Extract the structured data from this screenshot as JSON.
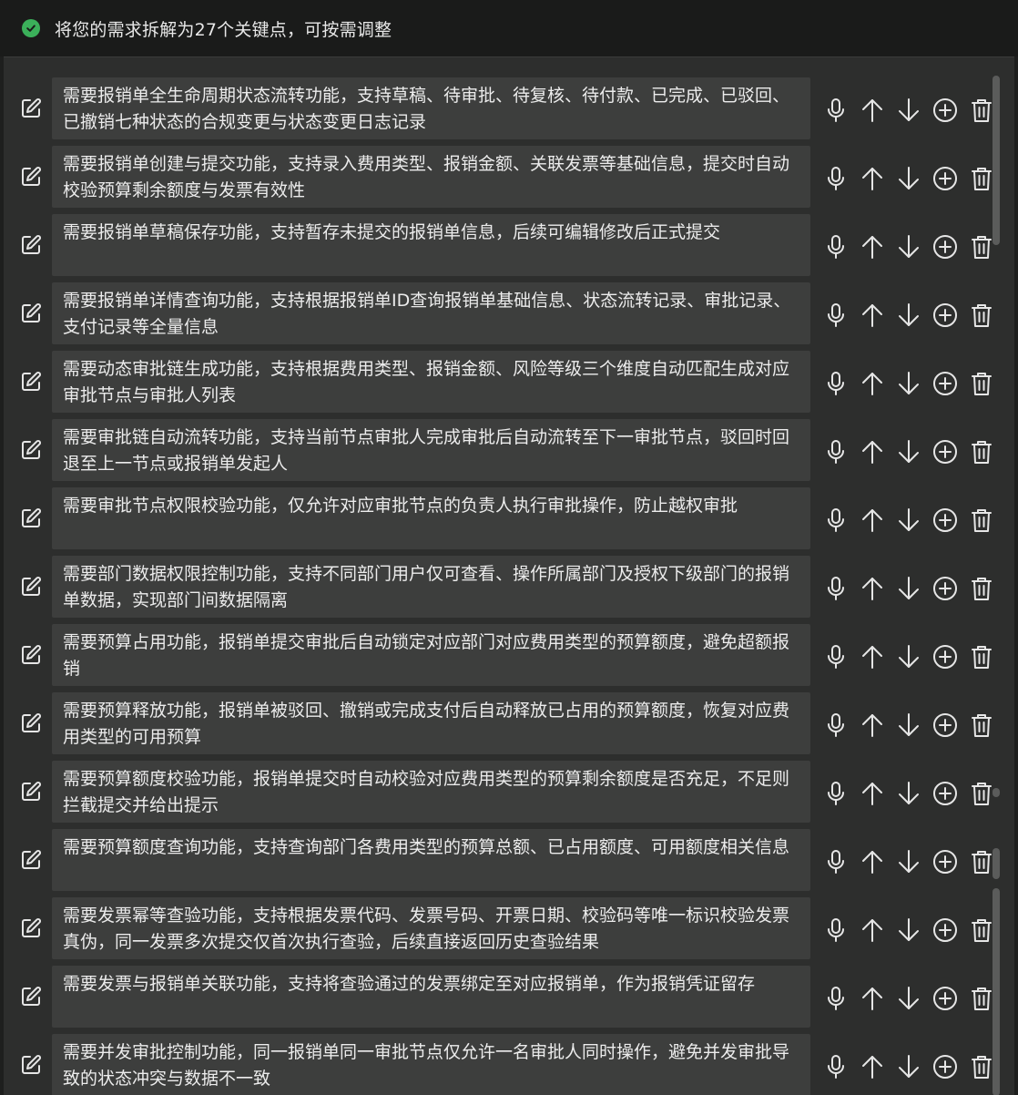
{
  "header": {
    "title": "将您的需求拆解为27个关键点，可按需调整",
    "status_icon": "check-circle-icon",
    "accent": "#3bb05a"
  },
  "items": [
    {
      "text": "需要报销单全生命周期状态流转功能，支持草稿、待审批、待复核、待付款、已完成、已驳回、已撤销七种状态的合规变更与状态变更日志记录"
    },
    {
      "text": "需要报销单创建与提交功能，支持录入费用类型、报销金额、关联发票等基础信息，提交时自动校验预算剩余额度与发票有效性"
    },
    {
      "text": "需要报销单草稿保存功能，支持暂存未提交的报销单信息，后续可编辑修改后正式提交"
    },
    {
      "text": "需要报销单详情查询功能，支持根据报销单ID查询报销单基础信息、状态流转记录、审批记录、支付记录等全量信息"
    },
    {
      "text": "需要动态审批链生成功能，支持根据费用类型、报销金额、风险等级三个维度自动匹配生成对应审批节点与审批人列表"
    },
    {
      "text": "需要审批链自动流转功能，支持当前节点审批人完成审批后自动流转至下一审批节点，驳回时回退至上一节点或报销单发起人"
    },
    {
      "text": "需要审批节点权限校验功能，仅允许对应审批节点的负责人执行审批操作，防止越权审批"
    },
    {
      "text": "需要部门数据权限控制功能，支持不同部门用户仅可查看、操作所属部门及授权下级部门的报销单数据，实现部门间数据隔离"
    },
    {
      "text": "需要预算占用功能，报销单提交审批后自动锁定对应部门对应费用类型的预算额度，避免超额报销"
    },
    {
      "text": "需要预算释放功能，报销单被驳回、撤销或完成支付后自动释放已占用的预算额度，恢复对应费用类型的可用预算"
    },
    {
      "text": "需要预算额度校验功能，报销单提交时自动校验对应费用类型的预算剩余额度是否充足，不足则拦截提交并给出提示"
    },
    {
      "text": "需要预算额度查询功能，支持查询部门各费用类型的预算总额、已占用额度、可用额度相关信息"
    },
    {
      "text": "需要发票幂等查验功能，支持根据发票代码、发票号码、开票日期、校验码等唯一标识校验发票真伪，同一发票多次提交仅首次执行查验，后续直接返回历史查验结果"
    },
    {
      "text": "需要发票与报销单关联功能，支持将查验通过的发票绑定至对应报销单，作为报销凭证留存"
    },
    {
      "text": "需要并发审批控制功能，同一报销单同一审批节点仅允许一名审批人同时操作，避免并发审批导致的状态冲突与数据不一致"
    }
  ],
  "row_actions": [
    {
      "name": "mic-icon",
      "label": "voice"
    },
    {
      "name": "arrow-up-icon",
      "label": "move-up"
    },
    {
      "name": "arrow-down-icon",
      "label": "move-down"
    },
    {
      "name": "plus-circle-icon",
      "label": "add"
    },
    {
      "name": "trash-icon",
      "label": "delete"
    }
  ],
  "colors": {
    "background": "#1e1f1e",
    "panel": "#2d2e2d",
    "row_box": "#3d3e3d",
    "text": "#ececec"
  }
}
